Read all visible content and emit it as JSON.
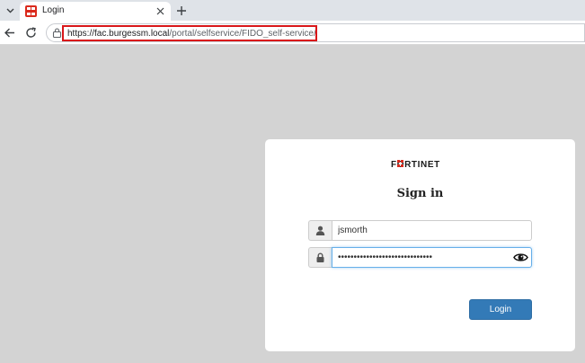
{
  "browser": {
    "tab": {
      "title": "Login"
    },
    "omnibox": {
      "url_host": "https://fac.burgessm.local",
      "url_path": "/portal/selfservice/FIDO_self-service/"
    }
  },
  "login": {
    "brand": "FORTINET",
    "title": "Sign in",
    "username_value": "jsmorth",
    "password_mask": "••••••••••••••••••••••••••••••",
    "login_label": "Login"
  },
  "colors": {
    "accent": "#337ab7",
    "highlight": "#d9171a",
    "fortinet_red": "#da291c",
    "page_bg": "#d3d3d3"
  },
  "icons": {
    "tab_dropdown": "chevron-down-icon",
    "favicon": "fortinet-favicon-icon",
    "close": "close-icon",
    "new_tab": "plus-icon",
    "back": "back-arrow-icon",
    "reload": "reload-icon",
    "site_info": "site-info-icon",
    "user": "user-icon",
    "lock": "lock-icon",
    "eye": "eye-icon"
  }
}
